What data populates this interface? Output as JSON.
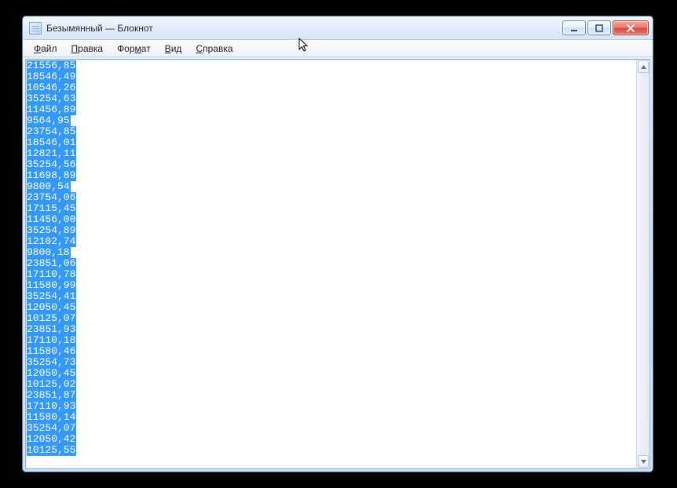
{
  "window": {
    "title": "Безымянный — Блокнот"
  },
  "menu": {
    "file": {
      "label": "Файл",
      "hotkey_index": 0
    },
    "edit": {
      "label": "Правка",
      "hotkey_index": 0
    },
    "format": {
      "label": "Формат",
      "hotkey_index": 3
    },
    "view": {
      "label": "Вид",
      "hotkey_index": 0
    },
    "help": {
      "label": "Справка",
      "hotkey_index": 0
    }
  },
  "content_lines": [
    "21556,85",
    "18546,49",
    "10546,26",
    "35254,63",
    "11456,89",
    "9564,95",
    "23754,85",
    "18546,01",
    "12821,11",
    "35254,56",
    "11698,89",
    "9800,54",
    "23754,06",
    "17115,45",
    "11456,00",
    "35254,89",
    "12102,74",
    "9800,18",
    "23851,06",
    "17110,78",
    "11580,99",
    "35254,41",
    "12050,45",
    "10125,07",
    "23851,93",
    "17110,18",
    "11580,46",
    "35254,73",
    "12050,45",
    "10125,02",
    "23851,87",
    "17110,93",
    "11580,14",
    "35254,07",
    "12050,42",
    "10125,55"
  ]
}
